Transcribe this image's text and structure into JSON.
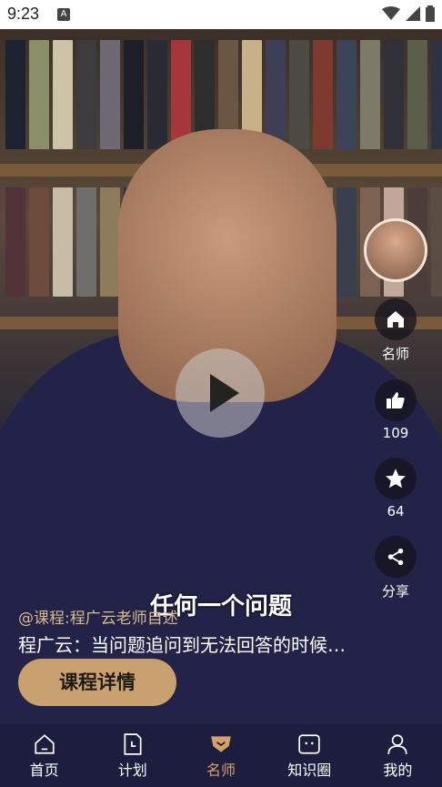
{
  "status_bar": {
    "time": "9:23",
    "badge": "A"
  },
  "player": {
    "subtitle_overlay": "任何一个问题",
    "course_tag": "@课程:程广云老师自述",
    "description": "程广云：当问题追问到无法回答的时候…",
    "detail_button": "课程详情"
  },
  "side_actions": {
    "home_label": "名师",
    "like_count": "109",
    "favorite_count": "64",
    "share_label": "分享"
  },
  "tabbar": {
    "tabs": [
      {
        "label": "首页",
        "icon": "home-icon"
      },
      {
        "label": "计划",
        "icon": "clock-doc-icon"
      },
      {
        "label": "名师",
        "icon": "teacher-icon",
        "active": true
      },
      {
        "label": "知识圈",
        "icon": "chat-dots-icon"
      },
      {
        "label": "我的",
        "icon": "user-icon"
      }
    ]
  },
  "colors": {
    "accent": "#C9A171",
    "active_tab": "#D3A16A"
  }
}
